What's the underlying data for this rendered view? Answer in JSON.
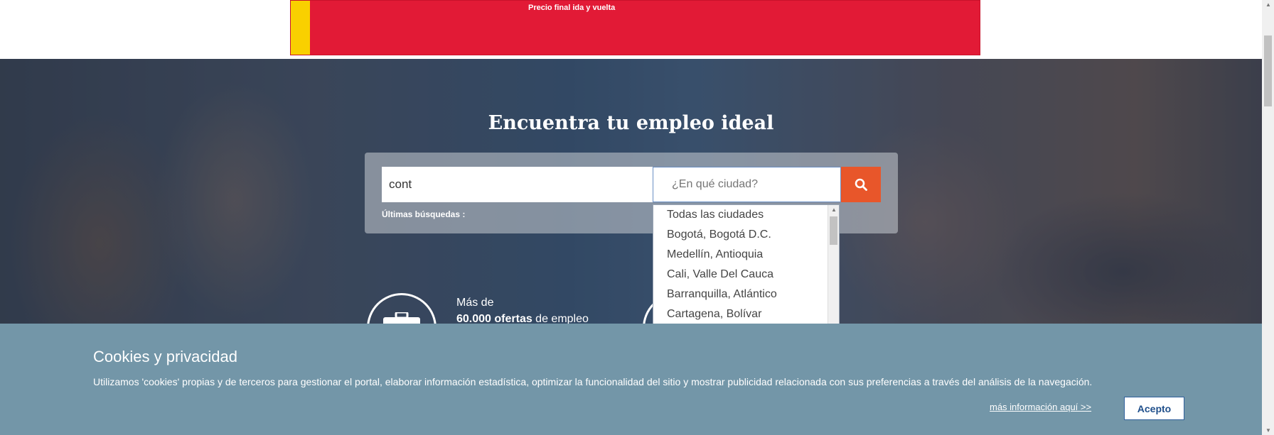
{
  "ad": {
    "text": "Precio final ida y vuelta"
  },
  "hero": {
    "title": "Encuentra tu empleo ideal",
    "keyword_value": "cont",
    "city_placeholder": "¿En qué ciudad?",
    "recent_label": "Últimas búsquedas :",
    "search_icon": "magnifier-icon"
  },
  "city_dropdown": {
    "items": [
      "Todas las ciudades",
      "Bogotá, Bogotá D.C.",
      "Medellín, Antioquia",
      "Cali, Valle Del Cauca",
      "Barranquilla, Atlántico",
      "Cartagena, Bolívar"
    ]
  },
  "stats": {
    "line1": "Más de",
    "line2_bold": "60.000 ofertas",
    "line2_rest": " de empleo"
  },
  "cookie": {
    "title": "Cookies y privacidad",
    "text": "Utilizamos 'cookies' propias y de terceros para gestionar el portal, elaborar información estadística, optimizar la funcionalidad del sitio y mostrar publicidad relacionada con sus preferencias a través del análisis de la navegación.",
    "more_link": "más información aquí >>",
    "accept": "Acepto"
  },
  "colors": {
    "ad_red": "#e21a36",
    "ad_yellow": "#f9d000",
    "search_orange": "#e8562a",
    "cookie_bg": "#7396a8"
  }
}
